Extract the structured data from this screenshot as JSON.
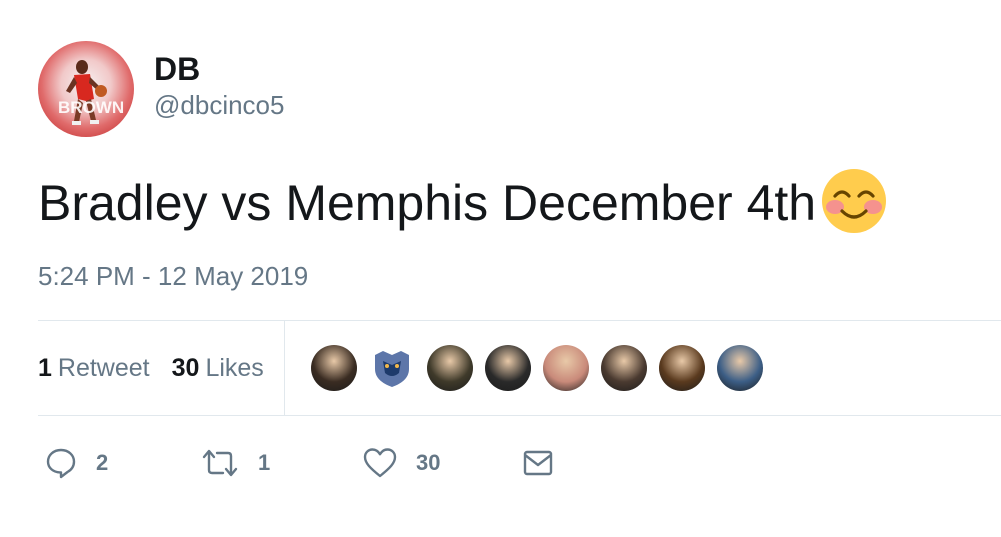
{
  "author": {
    "display_name": "DB",
    "handle": "@dbcinco5",
    "avatar_text": "BROWN"
  },
  "tweet": {
    "text": "Bradley vs Memphis December 4th",
    "emoji": "smiling-face-with-smiling-eyes",
    "timestamp": "5:24 PM - 12 May 2019"
  },
  "stats": {
    "retweets_count": "1",
    "retweets_label": "Retweet",
    "likes_count": "30",
    "likes_label": "Likes"
  },
  "likers": [
    {
      "name": "liker-avatar-1",
      "color": "#3a2c22"
    },
    {
      "name": "liker-avatar-2",
      "color": "#5d76a9"
    },
    {
      "name": "liker-avatar-3",
      "color": "#3f3a2a"
    },
    {
      "name": "liker-avatar-4",
      "color": "#2a2a2a"
    },
    {
      "name": "liker-avatar-5",
      "color": "#c98a7a"
    },
    {
      "name": "liker-avatar-6",
      "color": "#4a3a30"
    },
    {
      "name": "liker-avatar-7",
      "color": "#5a3a1e"
    },
    {
      "name": "liker-avatar-8",
      "color": "#3c5e86"
    }
  ],
  "actions": {
    "reply_count": "2",
    "retweet_count": "1",
    "like_count": "30"
  },
  "colors": {
    "text_primary": "#14171a",
    "text_secondary": "#657786",
    "divider": "#e1e8ed",
    "emoji_face": "#ffcc4d"
  }
}
